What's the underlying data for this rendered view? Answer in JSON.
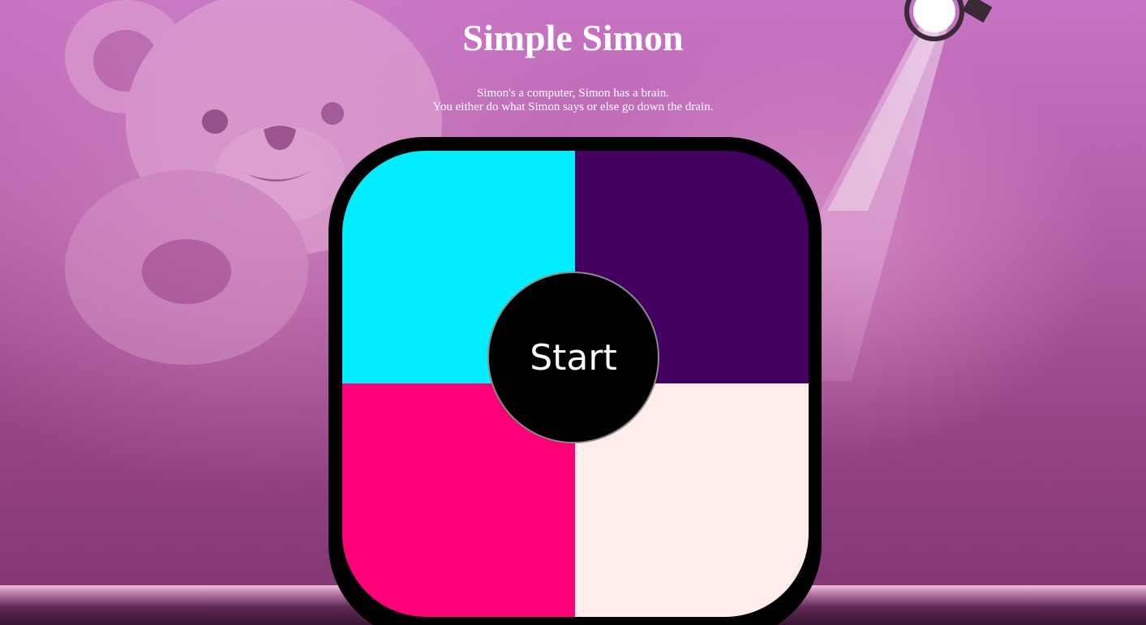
{
  "header": {
    "title": "Simple Simon",
    "tagline_line1": "Simon's a computer, Simon has a brain.",
    "tagline_line2": "You either do what Simon says or else go down the drain."
  },
  "board": {
    "pads": [
      {
        "id": "top-left",
        "color": "#00eeff"
      },
      {
        "id": "top-right",
        "color": "#440060"
      },
      {
        "id": "bottom-left",
        "color": "#ff0078"
      },
      {
        "id": "bottom-right",
        "color": "#ffeceb"
      }
    ],
    "start_label": "Start"
  },
  "background": {
    "theme_colors": [
      "#c774c4",
      "#9a4689",
      "#7e3470"
    ],
    "decor": [
      "teddy-bear",
      "stage-spotlight",
      "stage-floor"
    ]
  }
}
